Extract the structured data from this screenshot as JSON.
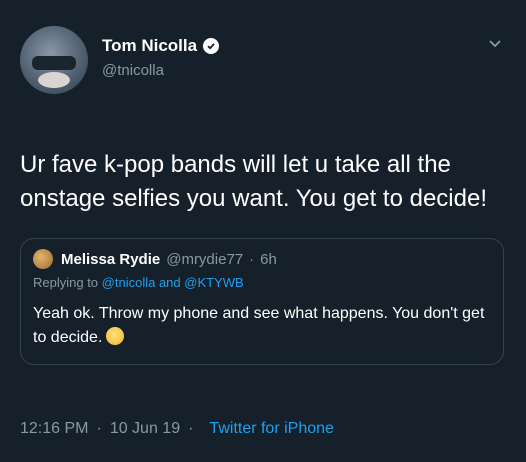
{
  "tweet": {
    "display_name": "Tom Nicolla",
    "handle": "@tnicolla",
    "text": "Ur fave k-pop bands will let u take all the onstage selfies you want. You get to decide!",
    "time": "12:16 PM",
    "date": "10 Jun 19",
    "source": "Twitter for iPhone",
    "verified_icon": "verified-badge-icon",
    "menu_icon": "chevron-down-icon"
  },
  "quote": {
    "display_name": "Melissa Rydie",
    "handle": "@mrydie77",
    "time": "6h",
    "reply_prefix": "Replying to",
    "reply_handles": "@tnicolla and @KTYWB",
    "text": "Yeah ok. Throw my phone and see what happens. You don't get to decide.",
    "emoji": "grinning-face-emoji"
  },
  "colors": {
    "background": "#15202b",
    "text": "#ffffff",
    "secondary": "#8899a6",
    "accent": "#1da1f2",
    "border": "#38444d"
  }
}
